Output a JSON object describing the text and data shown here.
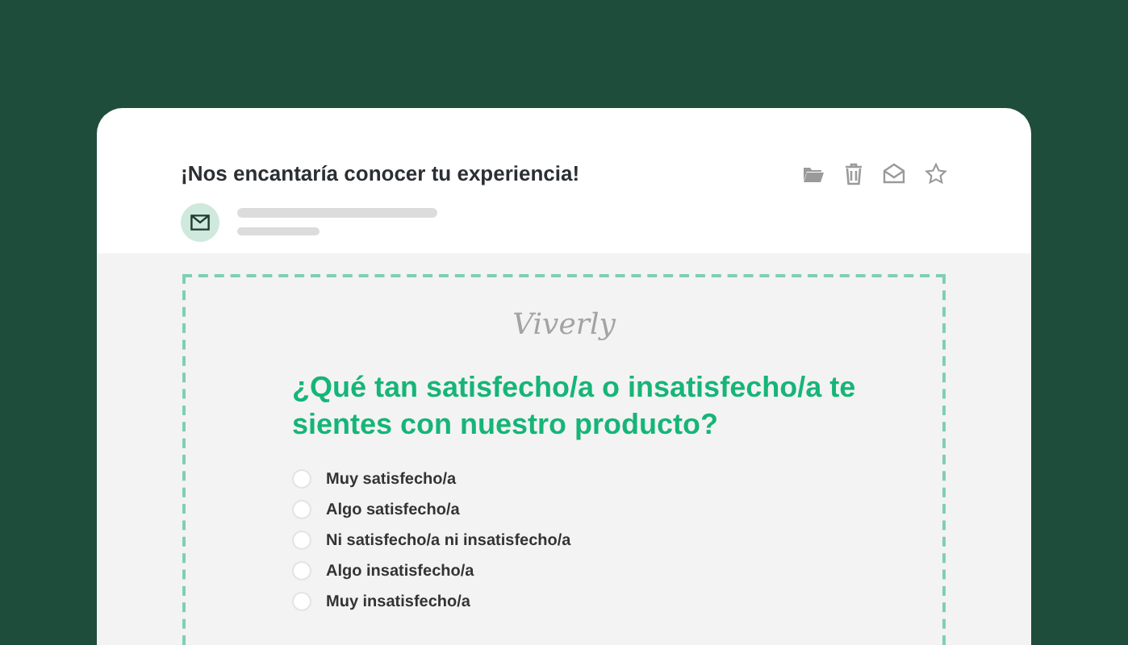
{
  "email": {
    "subject": "¡Nos encantaría conocer tu experiencia!"
  },
  "survey": {
    "brand": "Viverly",
    "question": "¿Qué tan satisfecho/a o insatisfecho/a te sientes con nuestro producto?",
    "options": [
      {
        "label": "Muy satisfecho/a",
        "selected": false
      },
      {
        "label": "Algo satisfecho/a",
        "selected": false
      },
      {
        "label": "Ni satisfecho/a ni insatisfecho/a",
        "selected": false
      },
      {
        "label": "Algo insatisfecho/a",
        "selected": false
      },
      {
        "label": "Muy insatisfecho/a",
        "selected": false
      }
    ]
  }
}
